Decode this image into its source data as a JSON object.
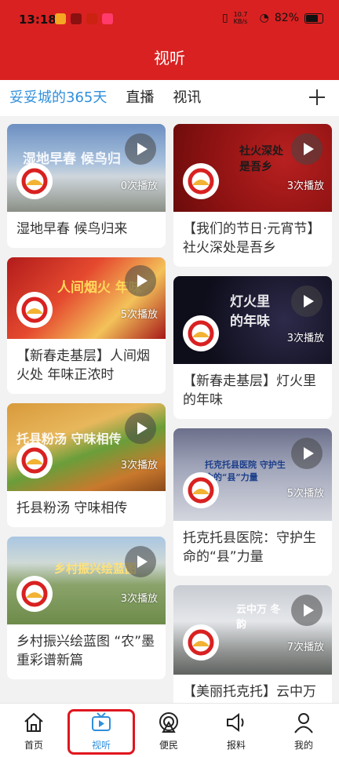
{
  "status_bar": {
    "time": "13:18",
    "network_speed": "10.7 KB/s",
    "battery": "82%"
  },
  "header": {
    "title": "视听"
  },
  "tabs": [
    {
      "label": "妥妥城的365天",
      "active": true
    },
    {
      "label": "直播",
      "active": false
    },
    {
      "label": "视讯",
      "active": false
    }
  ],
  "left_cards": [
    {
      "title": "湿地早春 候鸟归来",
      "views": "0次播放",
      "overlay": "湿地早春 候鸟归"
    },
    {
      "title": "【新春走基层】人间烟火处 年味正浓时",
      "views": "5次播放",
      "overlay": "人间烟火 年味"
    },
    {
      "title": "托县粉汤 守味相传",
      "views": "3次播放",
      "overlay": "托县粉汤 守味相传"
    },
    {
      "title": "乡村振兴绘蓝图 “农”墨重彩谱新篇",
      "views": "3次播放",
      "overlay": "乡村振兴绘蓝图"
    }
  ],
  "right_cards": [
    {
      "title": "【我们的节日·元宵节】社火深处是吾乡",
      "views": "3次播放",
      "overlay": "社火深处是吾乡"
    },
    {
      "title": "【新春走基层】灯火里的年味",
      "views": "3次播放",
      "overlay": "灯火里的年味"
    },
    {
      "title": "托克托县医院：守护生命的“县”力量",
      "views": "5次播放",
      "overlay": "托克托县医院 守护生命的“县”力量"
    },
    {
      "title": "【美丽托克托】云中万",
      "views": "7次播放",
      "overlay": "云中万 冬韵"
    }
  ],
  "bottom_nav": [
    {
      "label": "首页",
      "icon": "home-icon",
      "active": false
    },
    {
      "label": "视听",
      "icon": "tv-icon",
      "active": true
    },
    {
      "label": "便民",
      "icon": "service-icon",
      "active": false
    },
    {
      "label": "报料",
      "icon": "megaphone-icon",
      "active": false
    },
    {
      "label": "我的",
      "icon": "user-icon",
      "active": false
    }
  ],
  "colors": {
    "brand_red": "#d92121",
    "active_blue": "#2f8fdc",
    "highlight": "#e0161e"
  }
}
